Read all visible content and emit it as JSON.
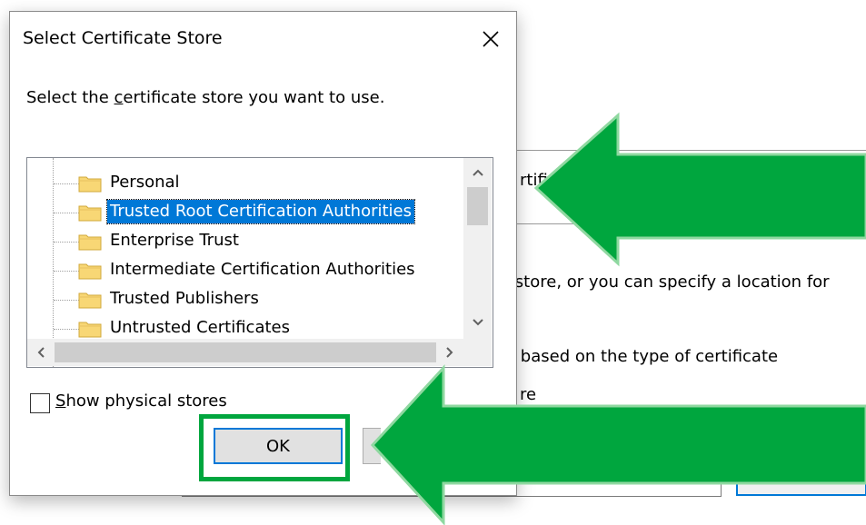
{
  "background": {
    "text_fragments": [
      "rtifi",
      "e store, or you can specify a location for",
      "e based on the type of certificate",
      "re"
    ]
  },
  "dialog": {
    "title": "Select Certificate Store",
    "prompt_before": "Select the ",
    "prompt_underlined": "c",
    "prompt_after": "ertificate store you want to use.",
    "tree_items": [
      {
        "label": "Personal",
        "selected": false
      },
      {
        "label": "Trusted Root Certification Authorities",
        "selected": true
      },
      {
        "label": "Enterprise Trust",
        "selected": false
      },
      {
        "label": "Intermediate Certification Authorities",
        "selected": false
      },
      {
        "label": "Trusted Publishers",
        "selected": false
      },
      {
        "label": "Untrusted Certificates",
        "selected": false
      }
    ],
    "show_physical_underlined": "S",
    "show_physical_rest": "how physical stores",
    "show_physical_checked": false,
    "ok_label": "OK"
  },
  "icons": {
    "close": "close-icon",
    "folder": "folder-icon",
    "scroll_up": "chevron-up-icon",
    "scroll_down": "chevron-down-icon",
    "scroll_left": "chevron-left-icon",
    "scroll_right": "chevron-right-icon"
  },
  "colors": {
    "selection": "#0078d7",
    "annotation_green": "#00a63e",
    "focus_blue": "#0078d7"
  }
}
